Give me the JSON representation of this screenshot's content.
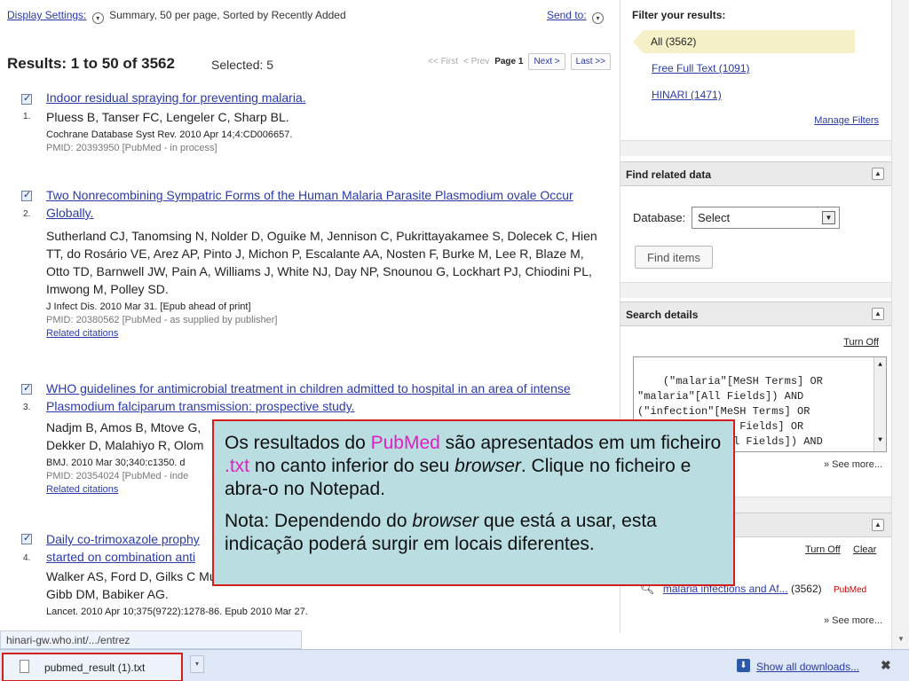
{
  "results": {
    "display_settings_label": "Display Settings:",
    "display_settings_value": "Summary, 50 per page, Sorted by Recently Added",
    "send_to_label": "Send to:",
    "title": "Results: 1 to 50 of 3562",
    "selected": "Selected: 5",
    "pager": {
      "first": "<< First",
      "prev": "< Prev",
      "page": "Page 1",
      "next": "Next >",
      "last": "Last >>"
    },
    "records": [
      {
        "num": "1.",
        "title": "Indoor residual spraying for preventing malaria.",
        "authors": "Pluess B, Tanser FC, Lengeler C, Sharp BL.",
        "citation": "Cochrane Database Syst Rev. 2010 Apr 14;4:CD006657.",
        "pmid": "PMID: 20393950 [PubMed - in process]",
        "related": ""
      },
      {
        "num": "2.",
        "title": "Two Nonrecombining Sympatric Forms of the Human Malaria Parasite Plasmodium ovale Occur Globally.",
        "authors": "Sutherland CJ, Tanomsing N, Nolder D, Oguike M, Jennison C, Pukrittayakamee S, Dolecek C, Hien TT, do Rosário VE, Arez AP, Pinto J, Michon P, Escalante AA, Nosten F, Burke M, Lee R, Blaze M, Otto TD, Barnwell JW, Pain A, Williams J, White NJ, Day NP, Snounou G, Lockhart PJ, Chiodini PL, Imwong M, Polley SD.",
        "citation": "J Infect Dis. 2010 Mar 31. [Epub ahead of print]",
        "pmid": "PMID: 20380562 [PubMed - as supplied by publisher]",
        "related": "Related citations"
      },
      {
        "num": "3.",
        "title": "WHO guidelines for antimicrobial treatment in children admitted to hospital in an area of intense Plasmodium falciparum transmission: prospective study.",
        "authors": "Nadjm B, Amos B, Mtove G, Dekker D, Malahiyo R, Olom",
        "citation": "BMJ. 2010 Mar 30;340:c1350. d",
        "pmid": "PMID: 20354024 [PubMed - inde",
        "related": "Related citations"
      },
      {
        "num": "4.",
        "title": "Daily co-trimoxazole prophy started on combination anti",
        "authors": "Walker AS, Ford D, Gilks C Mugyenyi P, Hakim J, Darbyshire JH, Gibb DM, Babiker AG.",
        "citation": "Lancet. 2010 Apr 10;375(9722):1278-86. Epub 2010 Mar 27.",
        "pmid": "",
        "related": ""
      }
    ]
  },
  "sidebar": {
    "filter_heading": "Filter your results:",
    "filters": [
      "All (3562)",
      "Free Full Text (1091)",
      "HINARI (1471)"
    ],
    "manage_filters": "Manage Filters",
    "find_related_heading": "Find related data",
    "database_label": "Database:",
    "database_value": "Select",
    "find_items": "Find items",
    "search_details_heading": "Search details",
    "turn_off": "Turn Off",
    "query": "(\"malaria\"[MeSH Terms] OR\n\"malaria\"[All Fields]) AND\n(\"infection\"[MeSH Terms] OR\n\"infection\"[All Fields] OR\n\"infections\"[All Fields]) AND",
    "see_more": "» See more...",
    "recent_turn_off": "Turn Off",
    "recent_clear": "Clear",
    "recent_query": "malaria infections and Af...",
    "recent_count": "(3562)",
    "recent_db": "PubMed",
    "recent_see_more": "» See more..."
  },
  "browser": {
    "status_url": "hinari-gw.who.int/.../entrez",
    "download_file": "pubmed_result (1).txt",
    "show_all": "Show all downloads...",
    "close": "✖"
  },
  "callout": {
    "p1_a": "Os resultados do ",
    "p1_pubmed": "PubMed",
    "p1_b": " são apresentados em um ficheiro ",
    "p1_txt": ".txt",
    "p1_c": " no canto inferior do seu ",
    "p1_browser": "browser",
    "p1_d": ". Clique no ficheiro e abra-o no Notepad.",
    "p2_a": "Nota: Dependendo do ",
    "p2_browser": "browser",
    "p2_b": " que está a usar, esta indicação poderá surgir em locais diferentes."
  },
  "colors": {
    "link": "#2a3aa8",
    "callout_bg": "#b9dde1",
    "callout_border": "#d41e1e",
    "highlight": "#e020c0",
    "filter_selected": "#f6f0c8"
  }
}
